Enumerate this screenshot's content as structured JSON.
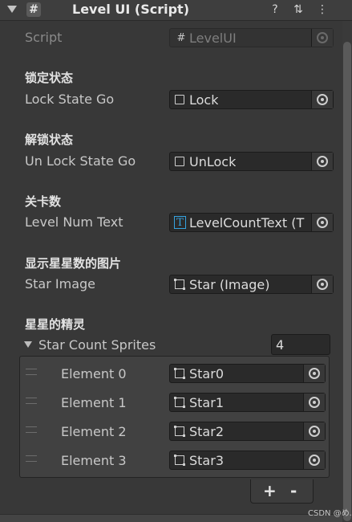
{
  "header": {
    "title": "Level UI (Script)",
    "script_icon": "#",
    "help_icon": "?",
    "settings_icon": "⇅",
    "menu_icon": "⋮"
  },
  "script_row": {
    "label": "Script",
    "value": "LevelUI"
  },
  "sections": [
    {
      "header": "锁定状态",
      "label": "Lock State Go",
      "value": "Lock"
    },
    {
      "header": "解锁状态",
      "label": "Un Lock State Go",
      "value": "UnLock"
    },
    {
      "header": "关卡数",
      "label": "Level Num Text",
      "value": "LevelCountText (T"
    },
    {
      "header": "显示星星数的图片",
      "label": "Star Image",
      "value": "Star (Image)"
    }
  ],
  "array": {
    "header": "星星的精灵",
    "label": "Star Count Sprites",
    "count": "4",
    "elements": [
      {
        "label": "Element 0",
        "value": "Star0"
      },
      {
        "label": "Element 1",
        "value": "Star1"
      },
      {
        "label": "Element 2",
        "value": "Star2"
      },
      {
        "label": "Element 3",
        "value": "Star3"
      }
    ],
    "add_label": "+",
    "remove_label": "-"
  },
  "watermark": "CSDN @め."
}
